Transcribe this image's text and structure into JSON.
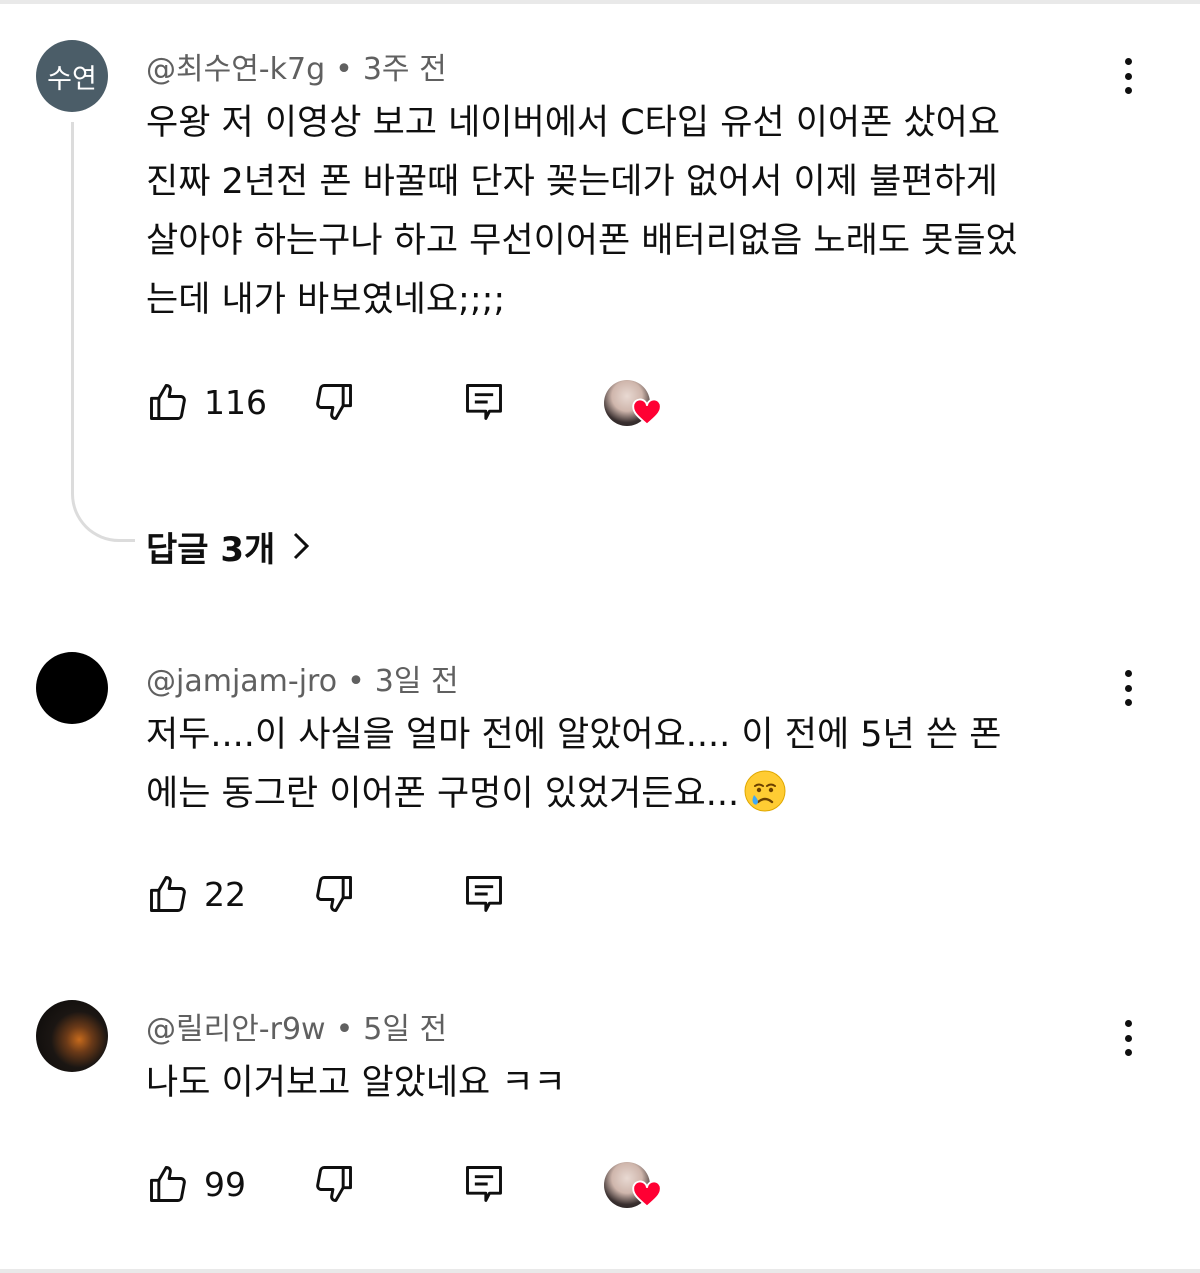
{
  "comments": [
    {
      "avatar_text": "수연",
      "handle": "@최수연-k7g",
      "time": "3주 전",
      "lines": [
        "우왕 저 이영상 보고 네이버에서 C타입 유선 이어폰 샀어요",
        "진짜 2년전 폰 바꿀때 단자 꽂는데가 없어서 이제 불편하게",
        "살아야 하는구나 하고 무선이어폰 배터리없음 노래도 못들었",
        "는데 내가 바보였네요;;;;"
      ],
      "likes": "116",
      "creator_heart": true,
      "replies_label": "답글 3개"
    },
    {
      "handle": "@jamjam-jro",
      "time": "3일 전",
      "lines": [
        "저두....이 사실을 얼마 전에 알았어요.... 이 전에 5년 쓴 폰",
        "에는 동그란 이어폰 구멍이 있었거든요..."
      ],
      "emoji": "crying-face",
      "likes": "22",
      "creator_heart": false
    },
    {
      "handle": "@릴리안-r9w",
      "time": "5일 전",
      "lines": [
        "나도 이거보고 알았네요 ㅋㅋ"
      ],
      "likes": "99",
      "creator_heart": true
    }
  ],
  "meta_separator": "•",
  "colors": {
    "text": "#0f0f0f",
    "meta": "#606060",
    "heart": "#ff0033",
    "avatar_initials_bg": "#4b5d68"
  },
  "icons": [
    "like-icon",
    "dislike-icon",
    "reply-icon",
    "more-icon",
    "heart-icon",
    "chevron-right-icon"
  ]
}
